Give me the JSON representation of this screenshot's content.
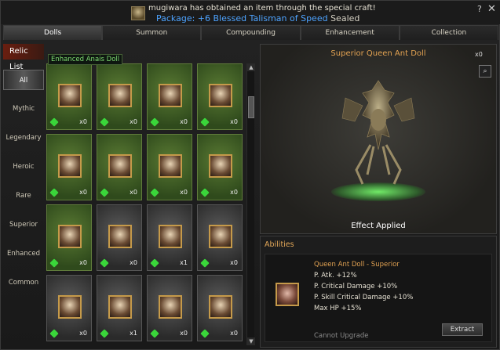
{
  "notice": {
    "line1": "mugiwara has obtained an item through the special craft!",
    "line2_main": "Package: +6 Blessed Talisman of Speed",
    "line2_suffix": " Sealed"
  },
  "window_controls": {
    "help": "?",
    "close": "✕"
  },
  "tabs": [
    {
      "label": "Dolls",
      "active": true
    },
    {
      "label": "Summon",
      "active": false
    },
    {
      "label": "Compounding",
      "active": false
    },
    {
      "label": "Enhancement",
      "active": false
    },
    {
      "label": "Collection",
      "active": false
    }
  ],
  "relic_list": {
    "title": "Relic List",
    "categories": [
      "All",
      "Mythic",
      "Legendary",
      "Heroic",
      "Rare",
      "Superior",
      "Enhanced",
      "Common"
    ],
    "active": "All"
  },
  "tooltip": "Enhanced Anais Doll",
  "grid": {
    "cards": [
      {
        "count": "x0",
        "tone": "green"
      },
      {
        "count": "x0",
        "tone": "green"
      },
      {
        "count": "x0",
        "tone": "green"
      },
      {
        "count": "x0",
        "tone": "green"
      },
      {
        "count": "x0",
        "tone": "green"
      },
      {
        "count": "x0",
        "tone": "green"
      },
      {
        "count": "x0",
        "tone": "green"
      },
      {
        "count": "x0",
        "tone": "green"
      },
      {
        "count": "x0",
        "tone": "green"
      },
      {
        "count": "x0",
        "tone": "gray"
      },
      {
        "count": "x1",
        "tone": "gray"
      },
      {
        "count": "x0",
        "tone": "gray"
      },
      {
        "count": "x0",
        "tone": "gray"
      },
      {
        "count": "x1",
        "tone": "gray"
      },
      {
        "count": "x0",
        "tone": "gray"
      },
      {
        "count": "x0",
        "tone": "gray"
      }
    ]
  },
  "scroll": {
    "up": "▲",
    "down": "▼"
  },
  "detail": {
    "title": "Superior Queen Ant Doll",
    "owned": "x0",
    "zoom_icon": "⌕",
    "effect": "Effect Applied"
  },
  "abilities": {
    "title": "Abilities",
    "name": "Queen Ant Doll - Superior",
    "stats": [
      "P. Atk. +12%",
      "P. Critical Damage +10%",
      "P. Skill Critical Damage +10%",
      "Max HP +15%"
    ],
    "cannot_upgrade": "Cannot Upgrade",
    "extract": "Extract"
  }
}
